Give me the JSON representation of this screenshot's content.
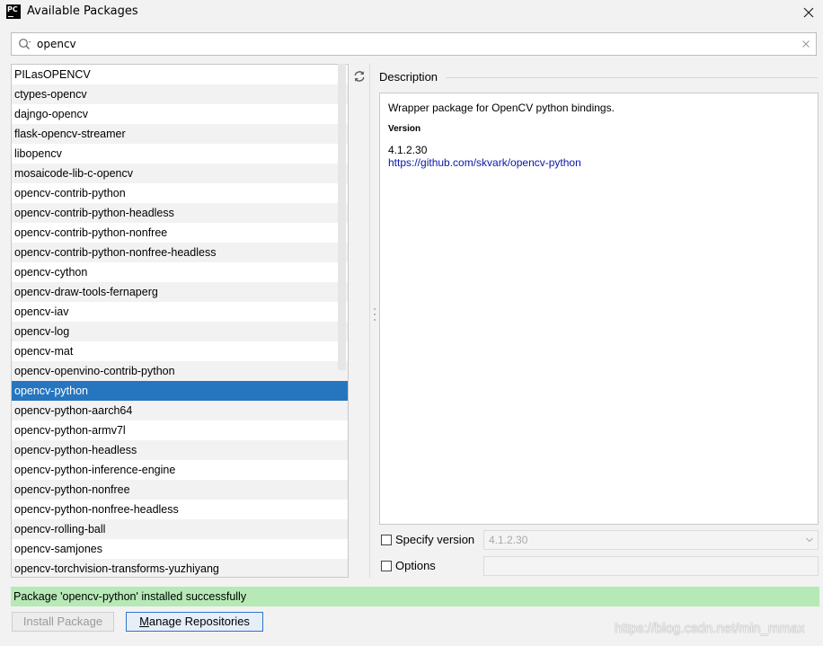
{
  "window": {
    "title": "Available Packages",
    "logo_text": "PC"
  },
  "search": {
    "value": "opencv"
  },
  "packages": [
    "PILasOPENCV",
    "ctypes-opencv",
    "dajngo-opencv",
    "flask-opencv-streamer",
    "libopencv",
    "mosaicode-lib-c-opencv",
    "opencv-contrib-python",
    "opencv-contrib-python-headless",
    "opencv-contrib-python-nonfree",
    "opencv-contrib-python-nonfree-headless",
    "opencv-cython",
    "opencv-draw-tools-fernaperg",
    "opencv-iav",
    "opencv-log",
    "opencv-mat",
    "opencv-openvino-contrib-python",
    "opencv-python",
    "opencv-python-aarch64",
    "opencv-python-armv7l",
    "opencv-python-headless",
    "opencv-python-inference-engine",
    "opencv-python-nonfree",
    "opencv-python-nonfree-headless",
    "opencv-rolling-ball",
    "opencv-samjones",
    "opencv-torchvision-transforms-yuzhiyang"
  ],
  "selected_package": "opencv-python",
  "description": {
    "header": "Description",
    "text": "Wrapper package for OpenCV python bindings.",
    "version_label": "Version",
    "version_value": "4.1.2.30",
    "homepage": "https://github.com/skvark/opencv-python"
  },
  "options": {
    "specify_version_label": "Specify version",
    "specify_version_checked": false,
    "version_select_value": "4.1.2.30",
    "options_label": "Options",
    "options_checked": false,
    "options_value": ""
  },
  "status": {
    "message": "Package 'opencv-python' installed successfully"
  },
  "buttons": {
    "install_label": "Install Package",
    "manage_repositories_label": "Manage Repositories"
  },
  "watermark": "https://blog.csdn.net/min_mmax",
  "colors": {
    "selection": "#2675bf",
    "status_success": "#b7e9b7",
    "link": "#0a17a8"
  }
}
